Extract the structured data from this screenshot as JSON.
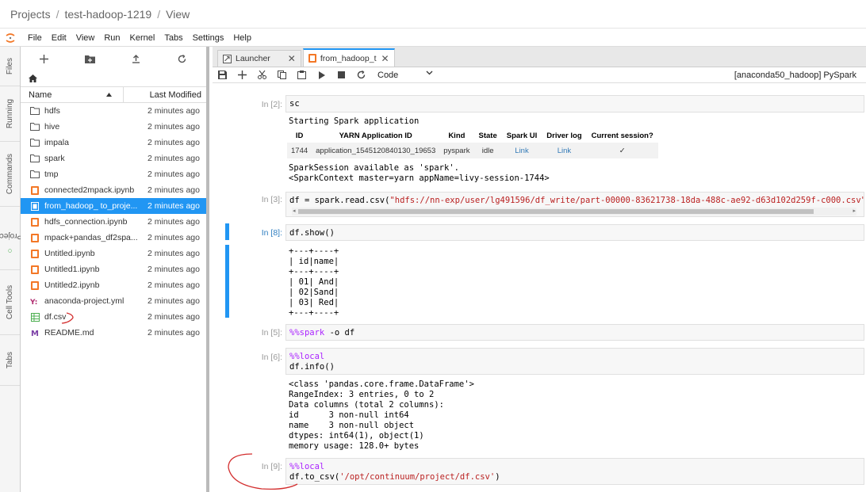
{
  "breadcrumb": {
    "root": "Projects",
    "project": "test-hadoop-1219",
    "page": "View",
    "separator": "/"
  },
  "menu": [
    "File",
    "Edit",
    "View",
    "Run",
    "Kernel",
    "Tabs",
    "Settings",
    "Help"
  ],
  "sidebar_tabs": [
    "Files",
    "Running",
    "Commands",
    "Project",
    "Cell Tools",
    "Tabs"
  ],
  "filebrowser": {
    "columns": {
      "name": "Name",
      "modified": "Last Modified"
    },
    "files": [
      {
        "name": "hdfs",
        "type": "folder",
        "modified": "2 minutes ago"
      },
      {
        "name": "hive",
        "type": "folder",
        "modified": "2 minutes ago"
      },
      {
        "name": "impala",
        "type": "folder",
        "modified": "2 minutes ago"
      },
      {
        "name": "spark",
        "type": "folder",
        "modified": "2 minutes ago"
      },
      {
        "name": "tmp",
        "type": "folder",
        "modified": "2 minutes ago"
      },
      {
        "name": "connected2mpack.ipynb",
        "type": "notebook",
        "modified": "2 minutes ago"
      },
      {
        "name": "from_hadoop_ to_proje...",
        "type": "notebook",
        "modified": "2 minutes ago",
        "selected": true
      },
      {
        "name": "hdfs_connection.ipynb",
        "type": "notebook",
        "modified": "2 minutes ago"
      },
      {
        "name": "mpack+pandas_df2spa...",
        "type": "notebook",
        "modified": "2 minutes ago"
      },
      {
        "name": "Untitled.ipynb",
        "type": "notebook",
        "modified": "2 minutes ago"
      },
      {
        "name": "Untitled1.ipynb",
        "type": "notebook",
        "modified": "2 minutes ago"
      },
      {
        "name": "Untitled2.ipynb",
        "type": "notebook",
        "modified": "2 minutes ago"
      },
      {
        "name": "anaconda-project.yml",
        "type": "yaml",
        "modified": "2 minutes ago"
      },
      {
        "name": "df.csv",
        "type": "csv",
        "modified": "2 minutes ago"
      },
      {
        "name": "README.md",
        "type": "markdown",
        "modified": "2 minutes ago"
      }
    ]
  },
  "tabs": [
    {
      "label": "Launcher",
      "active": false
    },
    {
      "label": "from_hadoop_t",
      "active": true
    }
  ],
  "toolbar": {
    "cell_type": "Code",
    "kernel": "[anaconda50_hadoop] PySpark"
  },
  "cells": {
    "c2": {
      "prompt": "In [2]:",
      "code": "sc",
      "output_intro": "Starting Spark application",
      "table": {
        "headers": [
          "ID",
          "YARN Application ID",
          "Kind",
          "State",
          "Spark UI",
          "Driver log",
          "Current session?"
        ],
        "row": [
          "1744",
          "application_1545120840130_19653",
          "pyspark",
          "idle",
          "Link",
          "Link",
          "✓"
        ]
      },
      "output_after": "SparkSession available as 'spark'.\n<SparkContext master=yarn appName=livy-session-1744>"
    },
    "c3": {
      "prompt": "In [3]:",
      "code_var": "df = spark.read.csv(",
      "code_str": "\"hdfs://nn-exp/user/lg491596/df_write/part-00000-83621738-18da-488c-ae92-d63d102d259f-c000.csv\"",
      "code_end": ","
    },
    "c8": {
      "prompt": "In [8]:",
      "code": "df.show()",
      "output": "+---+----+\n| id|name|\n+---+----+\n| 01| And|\n| 02|Sand|\n| 03| Red|\n+---+----+"
    },
    "c5": {
      "prompt": "In [5]:",
      "magic": "%%spark",
      "rest": " -o df"
    },
    "c6": {
      "prompt": "In [6]:",
      "magic": "%%local",
      "line2": "df.info()",
      "output": "<class 'pandas.core.frame.DataFrame'>\nRangeIndex: 3 entries, 0 to 2\nData columns (total 2 columns):\nid      3 non-null int64\nname    3 non-null object\ndtypes: int64(1), object(1)\nmemory usage: 128.0+ bytes"
    },
    "c9": {
      "prompt": "In [9]:",
      "magic": "%%local",
      "line2_pre": "df.to_csv(",
      "line2_str": "'/opt/continuum/project/df.csv'",
      "line2_end": ")"
    }
  }
}
